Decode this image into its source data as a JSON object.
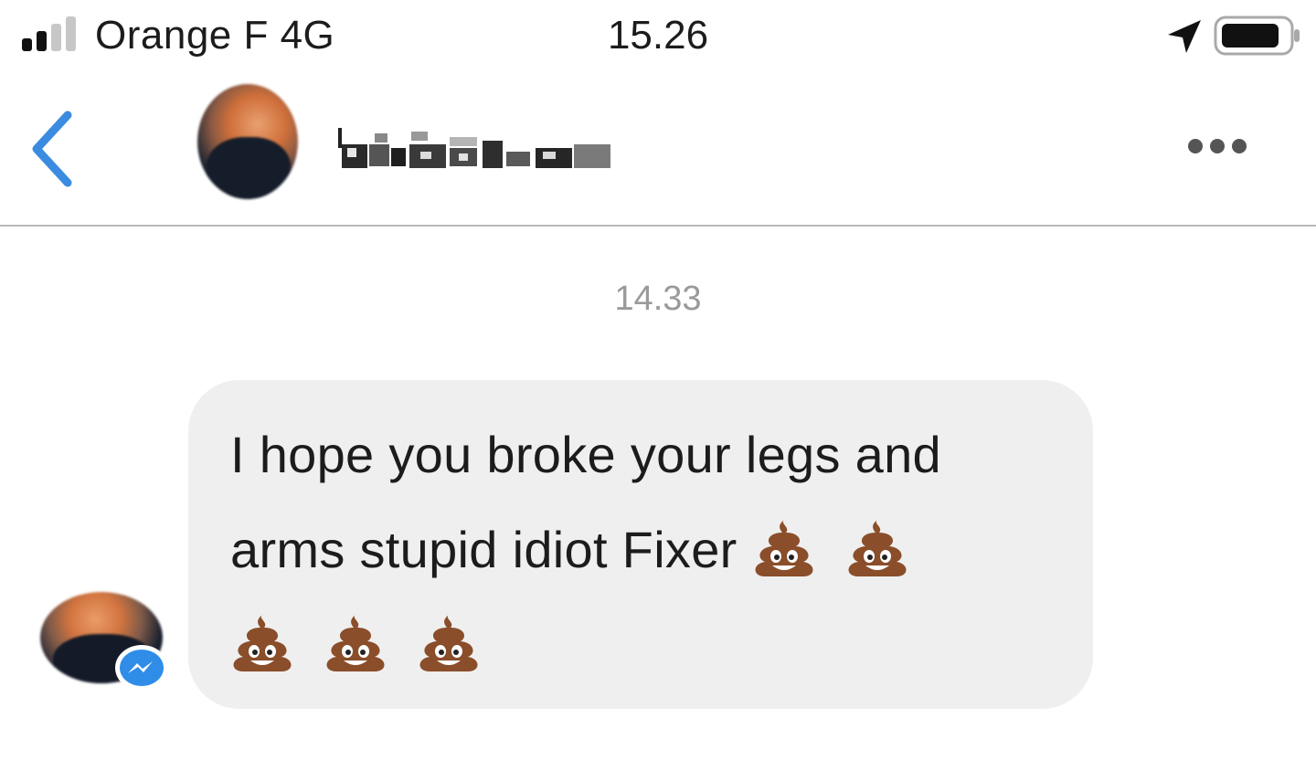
{
  "status_bar": {
    "carrier": "Orange F  4G",
    "time": "15.26",
    "signal_bars_filled": 2,
    "signal_bars_total": 4,
    "icons": [
      "signal-icon",
      "location-arrow-icon",
      "battery-icon"
    ]
  },
  "header": {
    "back_icon": "chevron-left-icon",
    "contact_name_redacted": true,
    "more_icon": "ellipsis-icon"
  },
  "conversation": {
    "timestamp": "14.33",
    "message": {
      "text": "I hope you broke your legs and arms stupid idiot Fixer",
      "emoji_icon": "pile-of-poo-icon",
      "emoji_count": 5
    },
    "sender_badge_icon": "messenger-icon"
  },
  "colors": {
    "accent_blue": "#3b8ce0",
    "bubble_gray": "#efefef",
    "timestamp_gray": "#9a9a9a",
    "divider": "#b8b8b8"
  }
}
